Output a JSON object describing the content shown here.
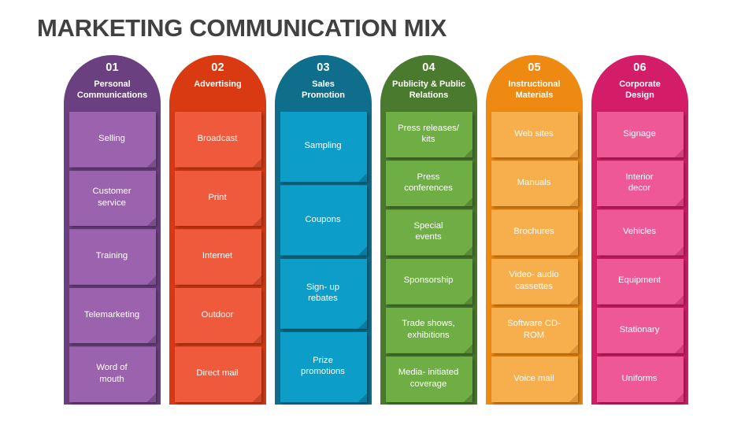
{
  "title": "MARKETING COMMUNICATION MIX",
  "title_color": "#414141",
  "background": "#ffffff",
  "columns": [
    {
      "number": "01",
      "name": "Personal\nCommunications",
      "header_color": "#6B4080",
      "card_color": "#9B63AE",
      "fold_color": "#7A4D8C",
      "items": [
        "Selling",
        "Customer\nservice",
        "Training",
        "Telemarketing",
        "Word of\nmouth"
      ]
    },
    {
      "number": "02",
      "name": "Advertising",
      "header_color": "#D93A11",
      "card_color": "#F05A3C",
      "fold_color": "#C8482C",
      "items": [
        "Broadcast",
        "Print",
        "Internet",
        "Outdoor",
        "Direct mail"
      ]
    },
    {
      "number": "03",
      "name": "Sales\nPromotion",
      "header_color": "#0E6E8C",
      "card_color": "#0D9DC9",
      "fold_color": "#0A7CA1",
      "items": [
        "Sampling",
        "Coupons",
        "Sign- up\nrebates",
        "Prize\npromotions"
      ]
    },
    {
      "number": "04",
      "name": "Publicity & Public\nRelations",
      "header_color": "#4A7A2E",
      "card_color": "#6FAE44",
      "fold_color": "#598C36",
      "items": [
        "Press releases/\nkits",
        "Press\nconferences",
        "Special\nevents",
        "Sponsorship",
        "Trade shows,\nexhibitions",
        "Media- initiated\ncoverage"
      ]
    },
    {
      "number": "05",
      "name": "Instructional\nMaterials",
      "header_color": "#EE8A12",
      "card_color": "#F7AE4C",
      "fold_color": "#DE9539",
      "items": [
        "Web sites",
        "Manuals",
        "Brochures",
        "Video- audio\ncassettes",
        "Software CD-\nROM",
        "Voice mail"
      ]
    },
    {
      "number": "06",
      "name": "Corporate\nDesign",
      "header_color": "#D31D68",
      "card_color": "#EE5896",
      "fold_color": "#D2407D",
      "items": [
        "Signage",
        "Interior\ndecor",
        "Vehicles",
        "Equipment",
        "Stationary",
        "Uniforms"
      ]
    }
  ]
}
